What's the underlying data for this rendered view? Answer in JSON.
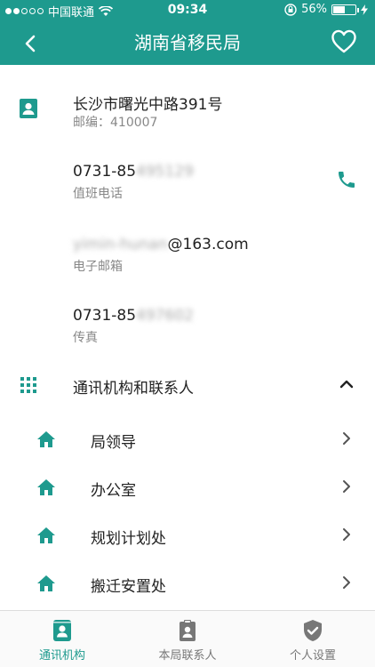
{
  "status": {
    "carrier": "中国联通",
    "time": "09:34",
    "battery_percent": "56%",
    "battery_level": 0.56
  },
  "nav": {
    "title": "湖南省移民局"
  },
  "address": {
    "line": "长沙市曙光中路391号",
    "postcode": "邮编：410007"
  },
  "phone": {
    "prefix": "0731-85",
    "hidden": "495129",
    "label": "值班电话"
  },
  "email": {
    "hidden": "yimin-hunan",
    "suffix": "@163.com",
    "label": "电子邮箱"
  },
  "fax": {
    "prefix": "0731-85",
    "hidden": "497602",
    "label": "传真"
  },
  "section": {
    "title": "通讯机构和联系人"
  },
  "departments": [
    {
      "label": "局领导"
    },
    {
      "label": "办公室"
    },
    {
      "label": "规划计划处"
    },
    {
      "label": "搬迁安置处"
    }
  ],
  "tabs": [
    {
      "label": "通讯机构"
    },
    {
      "label": "本局联系人"
    },
    {
      "label": "个人设置"
    }
  ],
  "colors": {
    "primary": "#1e9a8e",
    "text_secondary": "#888888"
  }
}
